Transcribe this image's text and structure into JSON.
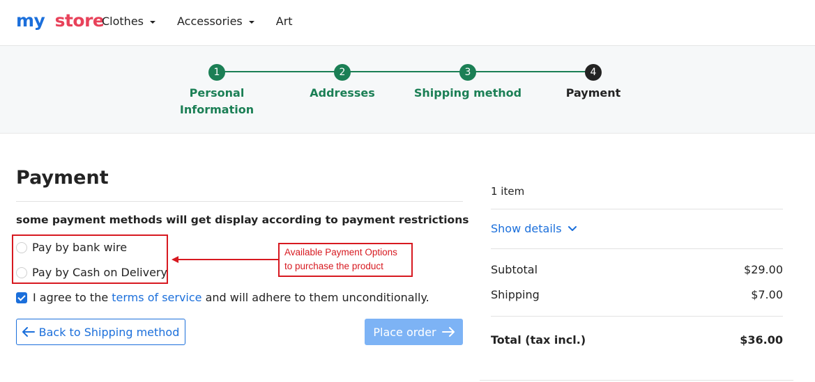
{
  "header": {
    "logo": {
      "part1": "my",
      "part2": "store"
    },
    "nav": [
      {
        "label": "Clothes",
        "has_dropdown": true
      },
      {
        "label": "Accessories",
        "has_dropdown": true
      },
      {
        "label": "Art",
        "has_dropdown": false
      }
    ]
  },
  "stepper": {
    "steps": [
      {
        "number": "1",
        "label_line1": "Personal",
        "label_line2": "Information",
        "state": "done"
      },
      {
        "number": "2",
        "label_line1": "Addresses",
        "label_line2": "",
        "state": "done"
      },
      {
        "number": "3",
        "label_line1": "Shipping method",
        "label_line2": "",
        "state": "done"
      },
      {
        "number": "4",
        "label_line1": "Payment",
        "label_line2": "",
        "state": "current"
      }
    ],
    "colors": {
      "done": "#1b7f55",
      "current": "#232323"
    }
  },
  "payment": {
    "title": "Payment",
    "notice": "some payment methods will get display according to payment restrictions",
    "options": [
      {
        "label": "Pay by bank wire",
        "selected": false
      },
      {
        "label": "Pay by Cash on Delivery",
        "selected": false
      }
    ],
    "annotation": {
      "line1": "Available Payment Options",
      "line2": "to purchase the product",
      "color": "#d71920"
    },
    "terms": {
      "checked": true,
      "prefix": "I agree to the",
      "link": "terms of service",
      "suffix": "and will adhere to them unconditionally."
    },
    "back_button": "Back to Shipping method",
    "place_button": "Place order"
  },
  "summary": {
    "item_count": "1 item",
    "show_details": "Show details",
    "rows": [
      {
        "label": "Subtotal",
        "value": "$29.00"
      },
      {
        "label": "Shipping",
        "value": "$7.00"
      }
    ],
    "total": {
      "label": "Total (tax incl.)",
      "value": "$36.00"
    }
  },
  "colors": {
    "accent": "#1b6fdb",
    "success": "#1b7f55",
    "annotation": "#d71920"
  }
}
